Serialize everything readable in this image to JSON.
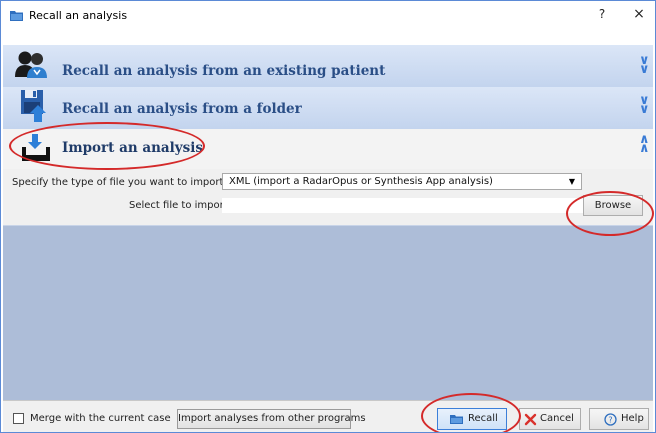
{
  "window": {
    "title": "Recall an analysis",
    "help_glyph": "?",
    "close_glyph": "×"
  },
  "panels": [
    {
      "title": "Recall an analysis from an existing patient",
      "icon": "patients-icon",
      "state": "collapsed"
    },
    {
      "title": "Recall an analysis from a folder",
      "icon": "save-to-folder-icon",
      "state": "collapsed"
    },
    {
      "title": "Import an analysis",
      "icon": "import-tray-icon",
      "state": "expanded"
    }
  ],
  "import": {
    "type_label": "Specify the type of file you want to import:",
    "type_value": "XML (import a RadarOpus or Synthesis App analysis)",
    "file_label": "Select file to import:",
    "file_value": "",
    "browse_label": "Browse"
  },
  "footer": {
    "merge_label": "Merge with the current case",
    "merge_checked": false,
    "import_other_label": "Import analyses from other programs",
    "recall_label": "Recall",
    "cancel_label": "Cancel",
    "help_label": "Help"
  },
  "colors": {
    "panel_title": "#2a4e86",
    "accent_blue": "#3a7bd5",
    "empty_area": "#adbdd8",
    "annotation_red": "#d42a2a",
    "cancel_x": "#d9312b"
  }
}
